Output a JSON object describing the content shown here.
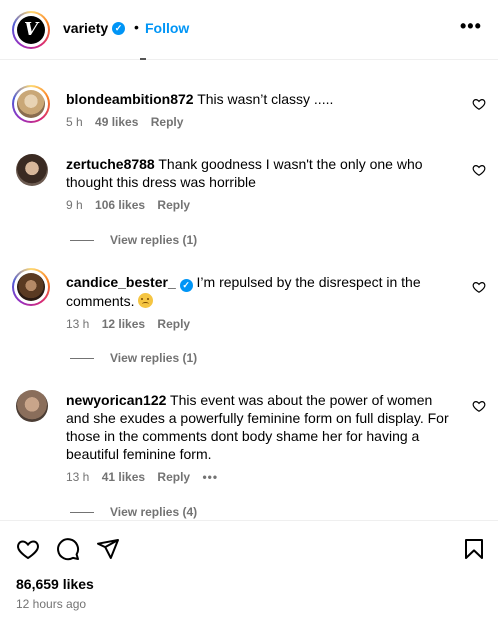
{
  "post": {
    "account": "variety",
    "logo_letter": "V",
    "verified_mark": "✓",
    "separator": "•",
    "follow_label": "Follow",
    "more_label": "•••",
    "likes_total": "86,659 likes",
    "timestamp": "12 hours ago"
  },
  "comments": [
    {
      "username": "blondeambition872",
      "text": "This wasn’t classy .....",
      "time": "5 h",
      "likes": "49 likes",
      "reply": "Reply"
    },
    {
      "username": "zertuche8788",
      "text": "Thank goodness I wasn't the only one who thought this dress was horrible",
      "time": "9 h",
      "likes": "106 likes",
      "reply": "Reply",
      "view_replies": "View replies (1)"
    },
    {
      "username": "candice_bester_",
      "text": "I’m repulsed by the disrespect in the comments.",
      "time": "13 h",
      "likes": "12 likes",
      "reply": "Reply",
      "view_replies": "View replies (1)",
      "emoji": "crying-face"
    },
    {
      "username": "newyorican122",
      "text": "This event was about the power of women and she exudes a powerfully feminine form on full display. For those in the comments dont body shame her for having a beautiful feminine form.",
      "time": "13 h",
      "likes": "41 likes",
      "reply": "Reply",
      "more": "•••",
      "view_replies": "View replies (4)"
    }
  ],
  "icons": {
    "like": "heart-icon",
    "comment": "comment-bubble-icon",
    "share": "paper-plane-icon",
    "save": "bookmark-icon",
    "verified": "verified-badge-icon"
  },
  "colors": {
    "accent": "#0095f6",
    "muted": "#737373",
    "divider": "#efefef"
  }
}
